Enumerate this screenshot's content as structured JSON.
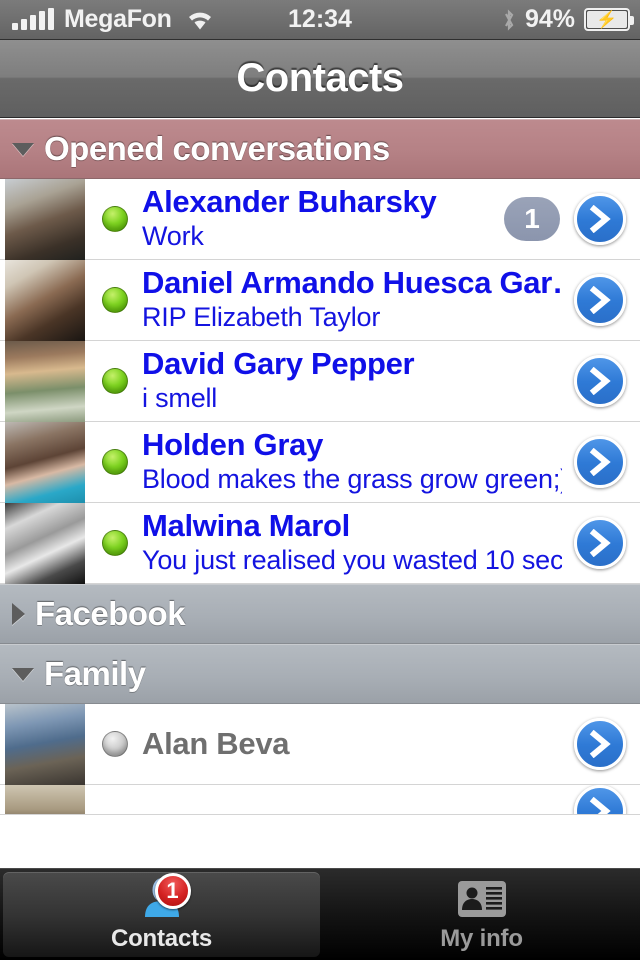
{
  "status_bar": {
    "carrier": "MegaFon",
    "time": "12:34",
    "battery_percent": "94%",
    "signal_icon": "signal-bars-icon",
    "wifi_icon": "wifi-icon",
    "bluetooth_icon": "bluetooth-icon",
    "battery_icon": "battery-charging-icon"
  },
  "navbar": {
    "title": "Contacts"
  },
  "sections": [
    {
      "title": "Opened conversations",
      "expanded": true,
      "style": "mauve",
      "toggle_icon": "triangle-down-icon",
      "rows": [
        {
          "name": "Alexander Buharsky",
          "status_text": "Work",
          "presence": "online",
          "badge": "1",
          "disclosure_icon": "chevron-right-icon",
          "avatar_icon": "avatar-image"
        },
        {
          "name": "Daniel Armando Huesca Gar…",
          "status_text": "RIP Elizabeth Taylor",
          "presence": "online",
          "badge": "",
          "disclosure_icon": "chevron-right-icon",
          "avatar_icon": "avatar-image"
        },
        {
          "name": "David Gary Pepper",
          "status_text": "i smell",
          "presence": "online",
          "badge": "",
          "disclosure_icon": "chevron-right-icon",
          "avatar_icon": "avatar-image"
        },
        {
          "name": "Holden Gray",
          "status_text": "Blood makes the grass grow green;).",
          "presence": "online",
          "badge": "",
          "disclosure_icon": "chevron-right-icon",
          "avatar_icon": "avatar-image"
        },
        {
          "name": "Malwina Marol",
          "status_text": "You just realised you wasted 10 sec…",
          "presence": "online",
          "badge": "",
          "disclosure_icon": "chevron-right-icon",
          "avatar_icon": "avatar-image"
        }
      ]
    },
    {
      "title": "Facebook",
      "expanded": false,
      "style": "gray",
      "toggle_icon": "triangle-right-icon",
      "rows": []
    },
    {
      "title": "Family",
      "expanded": true,
      "style": "gray",
      "toggle_icon": "triangle-down-icon",
      "rows": [
        {
          "name": "Alan Beva",
          "status_text": "",
          "presence": "offline",
          "badge": "",
          "disclosure_icon": "chevron-right-icon",
          "avatar_icon": "avatar-image"
        },
        {
          "name": "",
          "status_text": "",
          "presence": "offline",
          "badge": "",
          "disclosure_icon": "chevron-right-icon",
          "avatar_icon": "avatar-image"
        }
      ]
    }
  ],
  "tabbar": {
    "tabs": [
      {
        "label": "Contacts",
        "icon": "person-icon",
        "selected": true,
        "badge": "1"
      },
      {
        "label": "My info",
        "icon": "vcard-icon",
        "selected": false,
        "badge": ""
      }
    ]
  },
  "colors": {
    "link_blue": "#1414e0",
    "section_mauve": "#b58185",
    "section_gray": "#a8aeb5",
    "presence_online": "#7ed321",
    "presence_offline": "#cfcfcf",
    "badge_red": "#d42222",
    "disclosure_blue": "#2f7ad6"
  }
}
